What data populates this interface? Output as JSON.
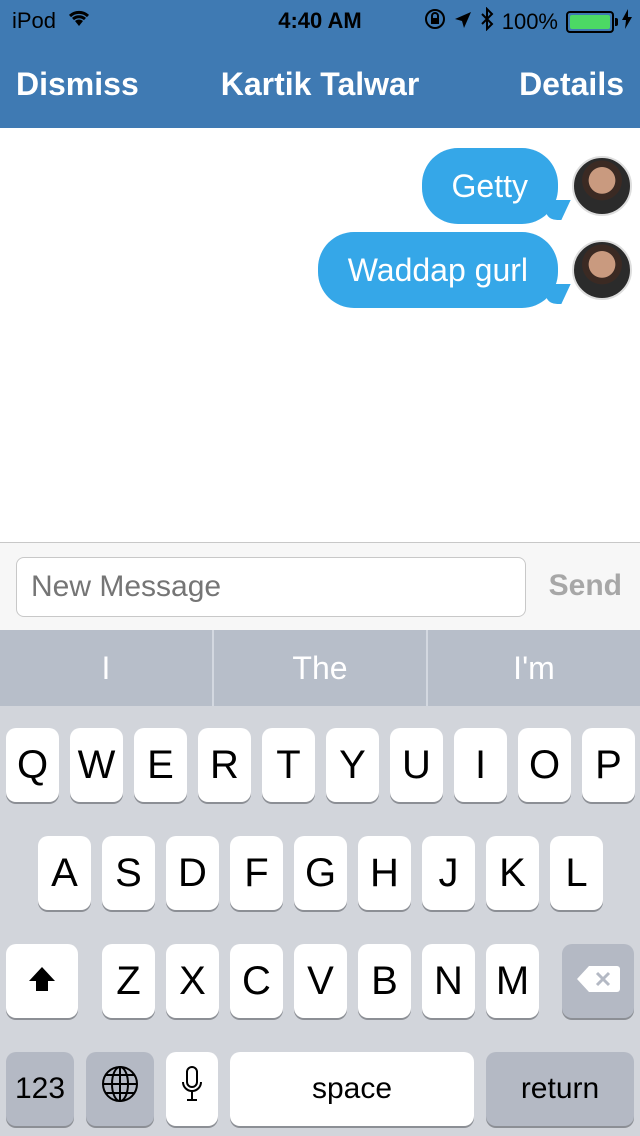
{
  "status_bar": {
    "device": "iPod",
    "time": "4:40 AM",
    "battery": "100%"
  },
  "nav": {
    "left_button": "Dismiss",
    "title": "Kartik Talwar",
    "right_button": "Details"
  },
  "messages": [
    {
      "text": "Getty"
    },
    {
      "text": "Waddap gurl"
    }
  ],
  "composer": {
    "placeholder": "New Message",
    "send_label": "Send"
  },
  "suggestions": [
    "I",
    "The",
    "I'm"
  ],
  "keyboard": {
    "row1": [
      "Q",
      "W",
      "E",
      "R",
      "T",
      "Y",
      "U",
      "I",
      "O",
      "P"
    ],
    "row2": [
      "A",
      "S",
      "D",
      "F",
      "G",
      "H",
      "J",
      "K",
      "L"
    ],
    "row3": [
      "Z",
      "X",
      "C",
      "V",
      "B",
      "N",
      "M"
    ],
    "numbers_label": "123",
    "space_label": "space",
    "return_label": "return"
  },
  "colors": {
    "nav_bg": "#3f7ab3",
    "bubble": "#35a7e8",
    "keyboard_bg": "#d2d5db"
  }
}
